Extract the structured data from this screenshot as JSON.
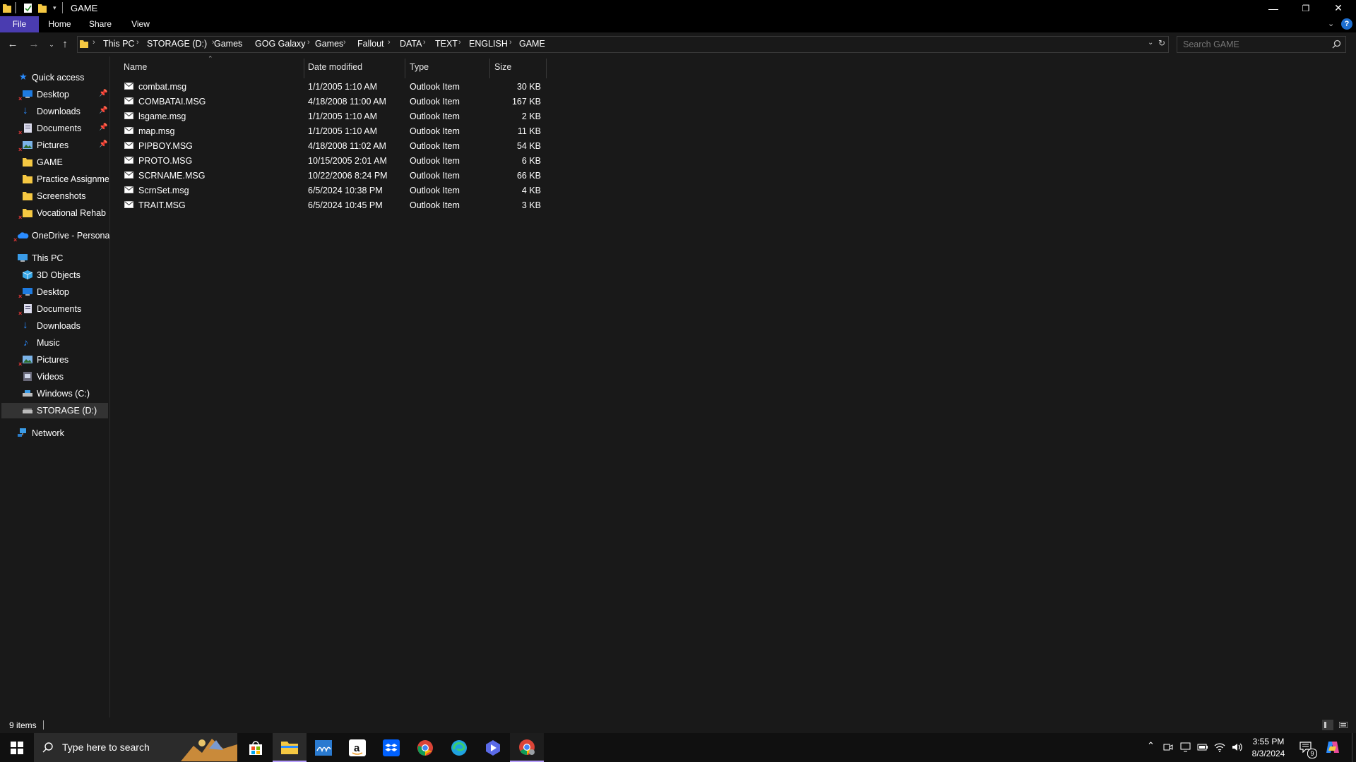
{
  "window": {
    "title": "GAME",
    "minimize": "—",
    "restore": "❐",
    "close": "✕"
  },
  "ribbon": {
    "tabs": [
      "File",
      "Home",
      "Share",
      "View"
    ]
  },
  "address": {
    "crumbs": [
      "This PC",
      "STORAGE (D:)",
      "Games",
      "GOG Galaxy",
      "Games",
      "Fallout",
      "DATA",
      "TEXT",
      "ENGLISH",
      "GAME"
    ]
  },
  "search": {
    "placeholder": "Search GAME"
  },
  "navpane": {
    "quick_access": "Quick access",
    "quick_items": [
      "Desktop",
      "Downloads",
      "Documents",
      "Pictures",
      "GAME",
      "Practice Assignmen",
      "Screenshots",
      "Vocational Rehab"
    ],
    "onedrive": "OneDrive - Personal",
    "thispc": "This PC",
    "pc_items": [
      "3D Objects",
      "Desktop",
      "Documents",
      "Downloads",
      "Music",
      "Pictures",
      "Videos",
      "Windows (C:)",
      "STORAGE (D:)"
    ],
    "network": "Network"
  },
  "columns": {
    "name": "Name",
    "date": "Date modified",
    "type": "Type",
    "size": "Size"
  },
  "files": [
    {
      "name": "combat.msg",
      "date": "1/1/2005 1:10 AM",
      "type": "Outlook Item",
      "size": "30 KB"
    },
    {
      "name": "COMBATAI.MSG",
      "date": "4/18/2008 11:00 AM",
      "type": "Outlook Item",
      "size": "167 KB"
    },
    {
      "name": "lsgame.msg",
      "date": "1/1/2005 1:10 AM",
      "type": "Outlook Item",
      "size": "2 KB"
    },
    {
      "name": "map.msg",
      "date": "1/1/2005 1:10 AM",
      "type": "Outlook Item",
      "size": "11 KB"
    },
    {
      "name": "PIPBOY.MSG",
      "date": "4/18/2008 11:02 AM",
      "type": "Outlook Item",
      "size": "54 KB"
    },
    {
      "name": "PROTO.MSG",
      "date": "10/15/2005 2:01 AM",
      "type": "Outlook Item",
      "size": "6 KB"
    },
    {
      "name": "SCRNAME.MSG",
      "date": "10/22/2006 8:24 PM",
      "type": "Outlook Item",
      "size": "66 KB"
    },
    {
      "name": "ScrnSet.msg",
      "date": "6/5/2024 10:38 PM",
      "type": "Outlook Item",
      "size": "4 KB"
    },
    {
      "name": "TRAIT.MSG",
      "date": "6/5/2024 10:45 PM",
      "type": "Outlook Item",
      "size": "3 KB"
    }
  ],
  "status": {
    "count": "9 items"
  },
  "taskbar": {
    "search_placeholder": "Type here to search",
    "time": "3:55 PM",
    "date": "8/3/2024",
    "notifications": "9"
  },
  "colors": {
    "file_tab": "#4a3cb0",
    "folder": "#f5c842",
    "selected": "#333333",
    "accent": "#0078d7"
  }
}
